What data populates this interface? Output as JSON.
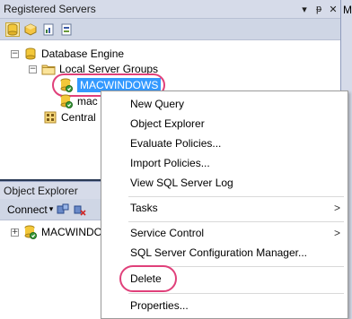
{
  "registered_servers": {
    "title": "Registered Servers",
    "title_buttons": [
      "▾",
      "ᵽ",
      "✕"
    ],
    "toolbar_icons": [
      "database-engine-icon",
      "analysis-services-icon",
      "reporting-services-icon",
      "integration-services-icon"
    ],
    "tree": {
      "root": "Database Engine",
      "group": "Local Server Groups",
      "selected_server": "MACWINDOWS",
      "second_server": "mac",
      "central": "Central"
    }
  },
  "object_explorer": {
    "title": "Object Explorer",
    "connect_label": "Connect",
    "connect_arrow": "▾",
    "tree_item": "MACWINDO"
  },
  "right_tab": {
    "letter": "M"
  },
  "context_menu": {
    "items": [
      {
        "label": "New Query"
      },
      {
        "label": "Object Explorer"
      },
      {
        "label": "Evaluate Policies..."
      },
      {
        "label": "Import Policies..."
      },
      {
        "label": "View SQL Server Log"
      },
      {
        "label": "Tasks",
        "submenu": true
      },
      {
        "label": "Service Control",
        "submenu": true
      },
      {
        "label": "SQL Server Configuration Manager..."
      },
      {
        "label": "Delete"
      },
      {
        "label": "Properties..."
      }
    ],
    "submenu_arrow": ">"
  },
  "highlight_color": "#e0407a",
  "selection_color": "#3399ff"
}
